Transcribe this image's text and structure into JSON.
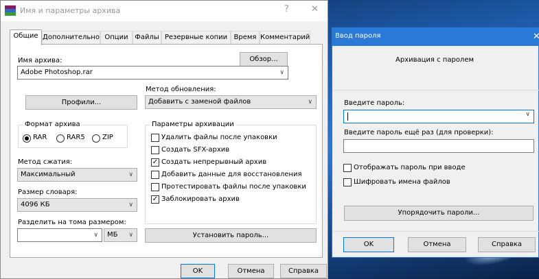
{
  "main": {
    "title": "Имя и параметры архива",
    "help": "?",
    "close": "✕",
    "tabs": [
      "Общие",
      "Дополнительно",
      "Опции",
      "Файлы",
      "Резервные копии",
      "Время",
      "Комментарий"
    ],
    "archive_name_label": "Имя архива:",
    "archive_name_value": "Adobe Photoshop.rar",
    "browse": "Обзор...",
    "update_method_label": "Метод обновления:",
    "update_method_value": "Добавить с заменой файлов",
    "profiles": "Профили...",
    "format_group": "Формат архива",
    "format_options": [
      "RAR",
      "RAR5",
      "ZIP"
    ],
    "format_selected": "RAR",
    "compression_label": "Метод сжатия:",
    "compression_value": "Максимальный",
    "dict_label": "Размер словаря:",
    "dict_value": "4096 КБ",
    "split_label": "Разделить на тома размером:",
    "split_value": "",
    "split_unit": "МБ",
    "params_group": "Параметры архивации",
    "params": [
      {
        "label": "Удалить файлы после упаковки",
        "checked": false
      },
      {
        "label": "Создать SFX-архив",
        "checked": false
      },
      {
        "label": "Создать непрерывный архив",
        "checked": true
      },
      {
        "label": "Добавить данные для восстановления",
        "checked": false
      },
      {
        "label": "Протестировать файлы после упаковки",
        "checked": false
      },
      {
        "label": "Заблокировать архив",
        "checked": true
      }
    ],
    "set_password": "Установить пароль...",
    "ok": "OK",
    "cancel": "Отмена",
    "help_btn": "Справка"
  },
  "pwd": {
    "title": "Ввод пароля",
    "close": "✕",
    "heading": "Архивация с паролем",
    "enter_label": "Введите пароль:",
    "enter_value": "",
    "reenter_label": "Введите пароль ещё раз (для проверки):",
    "reenter_value": "",
    "show_pwd": "Отображать пароль при вводе",
    "encrypt_names": "Шифровать имена файлов",
    "organize": "Упорядочить пароли...",
    "ok": "OK",
    "cancel": "Отмена",
    "help": "Справка"
  },
  "icons": {
    "check": "✓",
    "chevron": "∨"
  }
}
